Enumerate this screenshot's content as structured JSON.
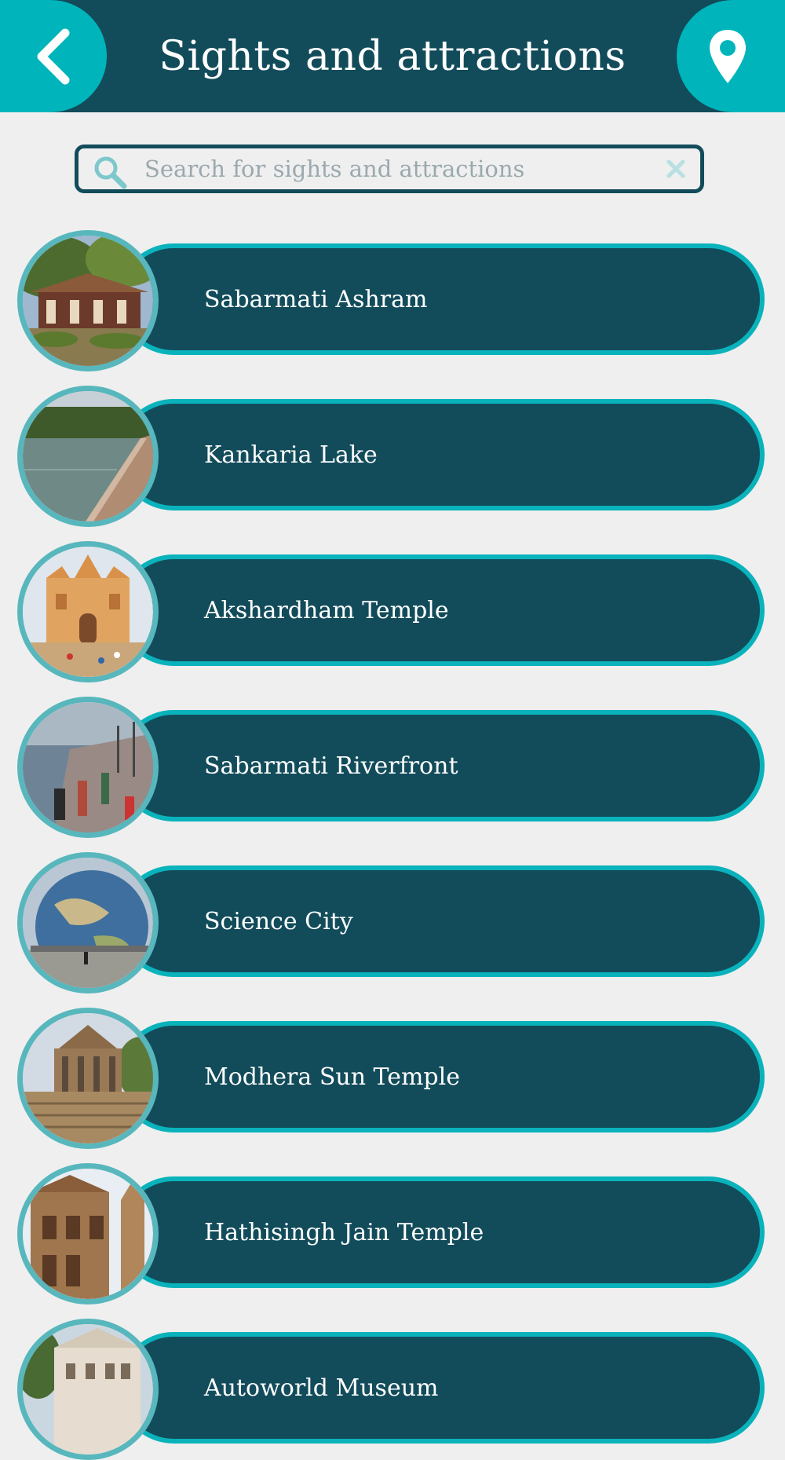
{
  "header": {
    "title": "Sights and attractions",
    "back_icon": "chevron-left-icon",
    "location_icon": "map-pin-icon"
  },
  "search": {
    "placeholder": "Search for sights and attractions",
    "value": ""
  },
  "colors": {
    "header_bg": "#124c5b",
    "accent": "#00b4bb",
    "pill_bg": "#124c5b",
    "pill_border": "#0ab3bb",
    "page_bg": "#efefef"
  },
  "attractions": [
    {
      "name": "Sabarmati Ashram"
    },
    {
      "name": "Kankaria Lake"
    },
    {
      "name": "Akshardham Temple"
    },
    {
      "name": "Sabarmati Riverfront"
    },
    {
      "name": "Science City"
    },
    {
      "name": "Modhera Sun Temple"
    },
    {
      "name": "Hathisingh Jain Temple"
    },
    {
      "name": "Autoworld Museum"
    }
  ]
}
